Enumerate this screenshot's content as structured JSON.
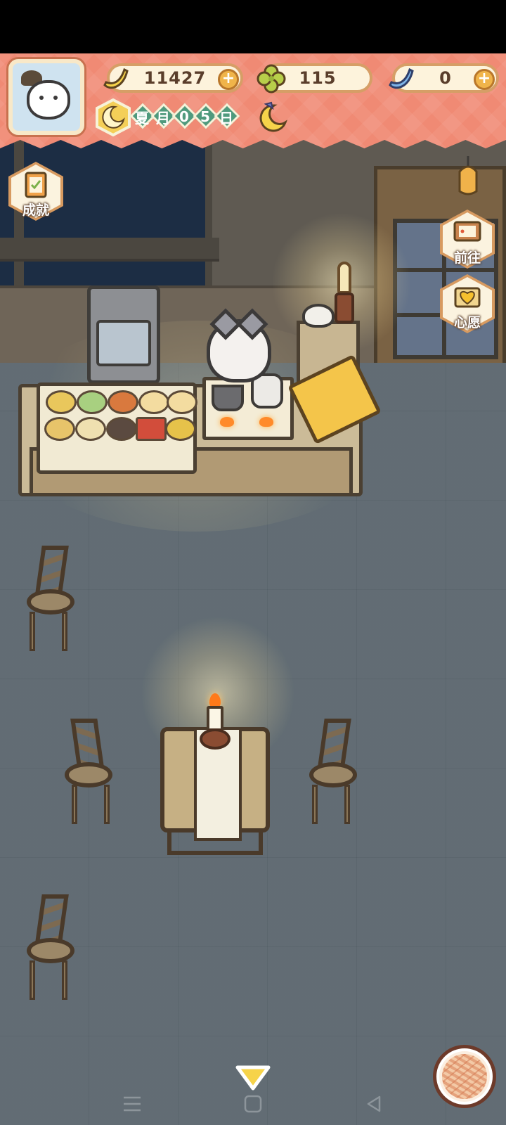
{
  "hud": {
    "banana_count": "11427",
    "clover_count": "115",
    "blue_banana_count": "0",
    "date": [
      "夏",
      "月",
      "0",
      "5",
      "日"
    ]
  },
  "side_buttons": {
    "achievements_label": "成就",
    "goto_label": "前往",
    "wishes_label": "心愿"
  },
  "colors": {
    "hud_bg": "#f08a74",
    "pill_bg": "#fdf3dc",
    "date_green": "#4f9a7d",
    "night_floor": "#5b666e"
  },
  "icons": {
    "avatar": "cat-avatar",
    "banana": "banana-icon",
    "clover": "clover-icon",
    "blue_banana": "blue-banana-icon",
    "moon_badge": "moon-badge-icon",
    "sleep_moon": "sleeping-moon-icon",
    "yarn": "yarn-ball-icon"
  }
}
